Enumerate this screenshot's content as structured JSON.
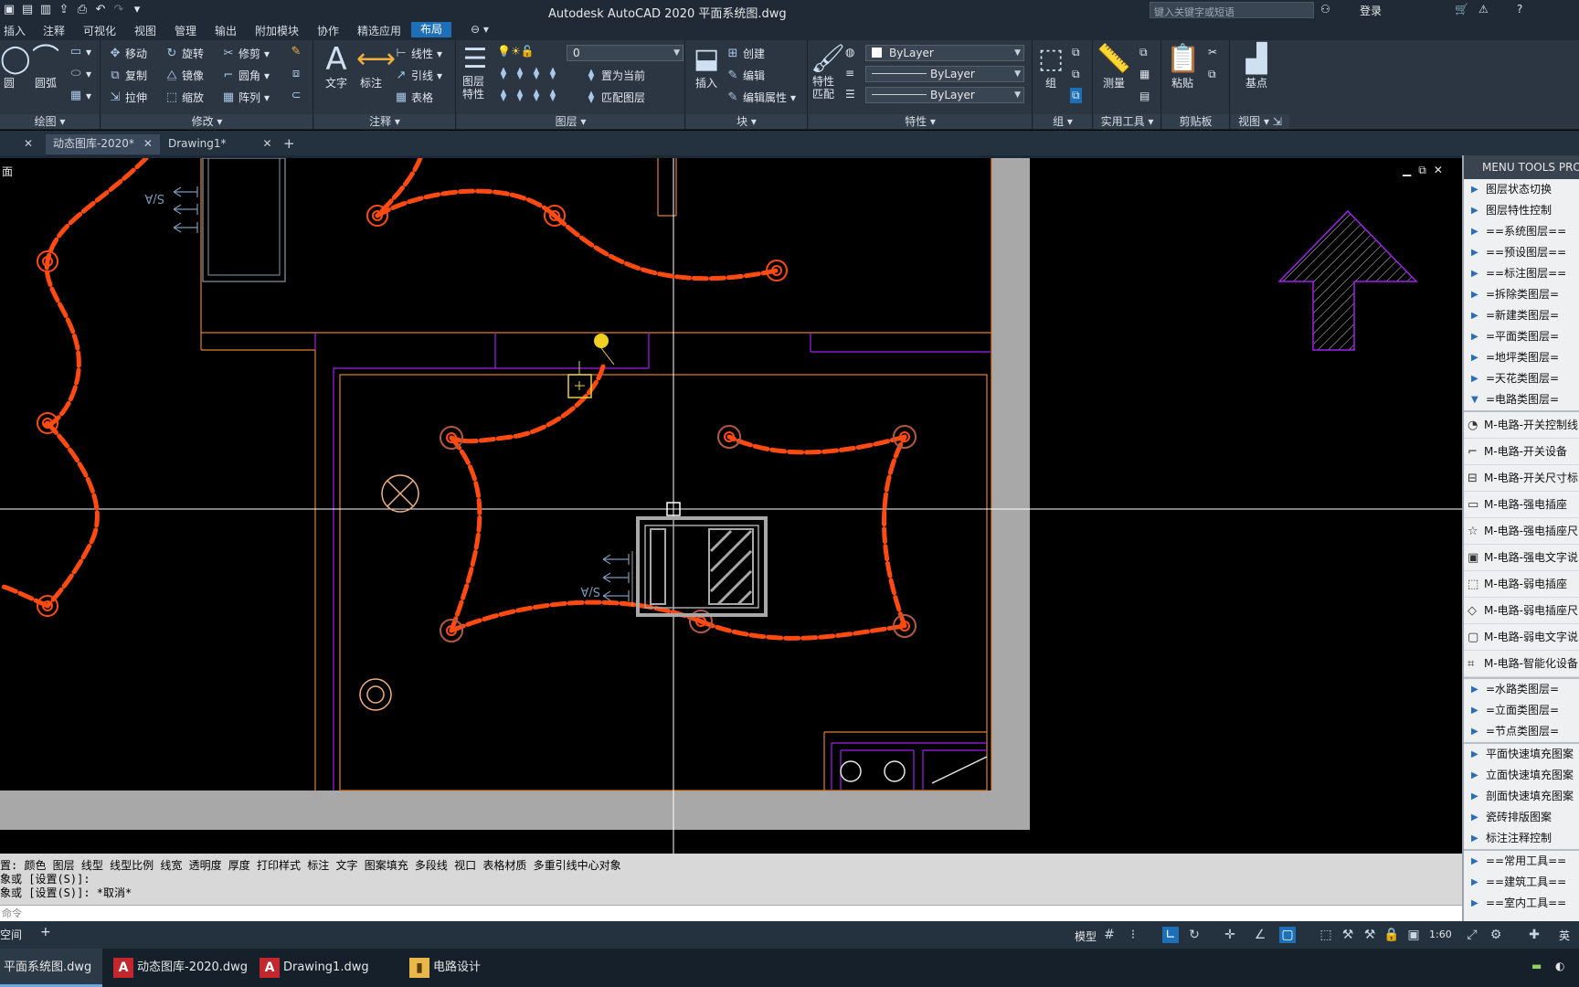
{
  "title_bar": {
    "title": "Autodesk AutoCAD 2020    平面系统图.dwg",
    "search_placeholder": "键入关键字或短语",
    "login": "登录"
  },
  "menu": {
    "items": [
      "插入",
      "注释",
      "可视化",
      "视图",
      "管理",
      "输出",
      "附加模块",
      "协作",
      "精选应用",
      "布局"
    ]
  },
  "ribbon": {
    "draw": {
      "circle": "圆",
      "arc": "圆弧",
      "title": "绘图"
    },
    "modify": {
      "move": "移动",
      "rotate": "旋转",
      "trim": "修剪",
      "copy": "复制",
      "mirror": "镜像",
      "fillet": "圆角",
      "stretch": "拉伸",
      "scale": "缩放",
      "array": "阵列",
      "title": "修改"
    },
    "annotation": {
      "text": "文字",
      "dimension": "标注",
      "linear": "线性",
      "leader": "引线",
      "table": "表格",
      "title": "注释"
    },
    "layers": {
      "layer_props": "图层特性",
      "layer_current": "0",
      "set_current": "置为当前",
      "match_layer": "匹配图层",
      "title": "图层"
    },
    "block": {
      "insert": "插入",
      "create": "创建",
      "edit": "编辑",
      "edit_attr": "编辑属性",
      "title": "块"
    },
    "properties": {
      "match": "特性匹配",
      "color": "ByLayer",
      "linetype": "ByLayer",
      "lineweight": "ByLayer",
      "title": "特性"
    },
    "groups": {
      "group": "组",
      "title": "组"
    },
    "utilities": {
      "measure": "测量",
      "title": "实用工具"
    },
    "clipboard": {
      "paste": "粘贴",
      "title": "剪贴板"
    },
    "view": {
      "base": "基点",
      "title": "视图"
    }
  },
  "doc_tabs": {
    "tab2": "动态图库-2020*",
    "tab3": "Drawing1*"
  },
  "drawing": {
    "viewport_label": "面",
    "labels": [
      "S/A",
      "S/A"
    ]
  },
  "palette": {
    "header": "MENU TOOLS PRO",
    "group_a": [
      "图层状态切换",
      "图层特性控制",
      "==系统图层==",
      "==预设图层==",
      "==标注图层==",
      "=拆除类图层=",
      "=新建类图层=",
      "=平面类图层=",
      "=地坪类图层=",
      "=天花类图层=",
      "=电路类图层="
    ],
    "tools": [
      "M-电路-开关控制线",
      "M-电路-开关设备",
      "M-电路-开关尺寸标",
      "M-电路-强电插座",
      "M-电路-强电插座尺",
      "M-电路-强电文字说",
      "M-电路-弱电插座",
      "M-电路-弱电插座尺",
      "M-电路-弱电文字说",
      "M-电路-智能化设备"
    ],
    "group_b": [
      "=水路类图层=",
      "=立面类图层=",
      "=节点类图层="
    ],
    "group_c": [
      "平面快速填充图案",
      "立面快速填充图案",
      "剖面快速填充图案",
      "瓷砖排版图案",
      "标注注释控制"
    ],
    "group_d": [
      "==常用工具==",
      "==建筑工具==",
      "==室内工具=="
    ]
  },
  "command": {
    "line1": "置: 颜色 图层 线型 线型比例 线宽 透明度 厚度 打印样式 标注 文字 图案填充 多段线 视口 表格材质 多重引线中心对象",
    "line2": "象或 [设置(S)]:",
    "line3": "象或 [设置(S)]: *取消*",
    "input_placeholder": "命令"
  },
  "status": {
    "layout_tab": "空间",
    "model": "模型",
    "scale": "1:60",
    "lang": "英"
  },
  "taskbar": {
    "items": [
      "平面系统图.dwg",
      "动态图库-2020.dwg",
      "Drawing1.dwg",
      "电路设计"
    ]
  },
  "colors": {
    "wire": "#ff4a12",
    "wall": "#a8a8a8",
    "purple": "#a020f0",
    "accent": "#1d6fb8"
  }
}
